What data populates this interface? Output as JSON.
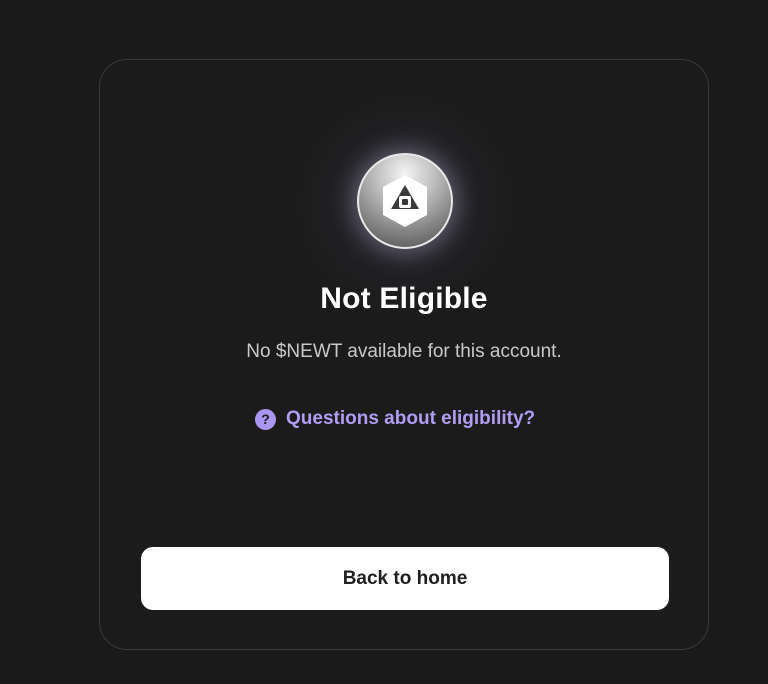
{
  "status": {
    "title": "Not Eligible",
    "message": "No $NEWT available for this account."
  },
  "help": {
    "link_label": "Questions about eligibility?",
    "icon_glyph": "?"
  },
  "actions": {
    "back_label": "Back to home"
  },
  "theme": {
    "background": "#1a1a1a",
    "card_border": "#3a3a3a",
    "accent": "#b09df2",
    "button_bg": "#ffffff"
  },
  "icons": {
    "logo": "newton-logo-icon",
    "help": "question-circle-icon"
  }
}
